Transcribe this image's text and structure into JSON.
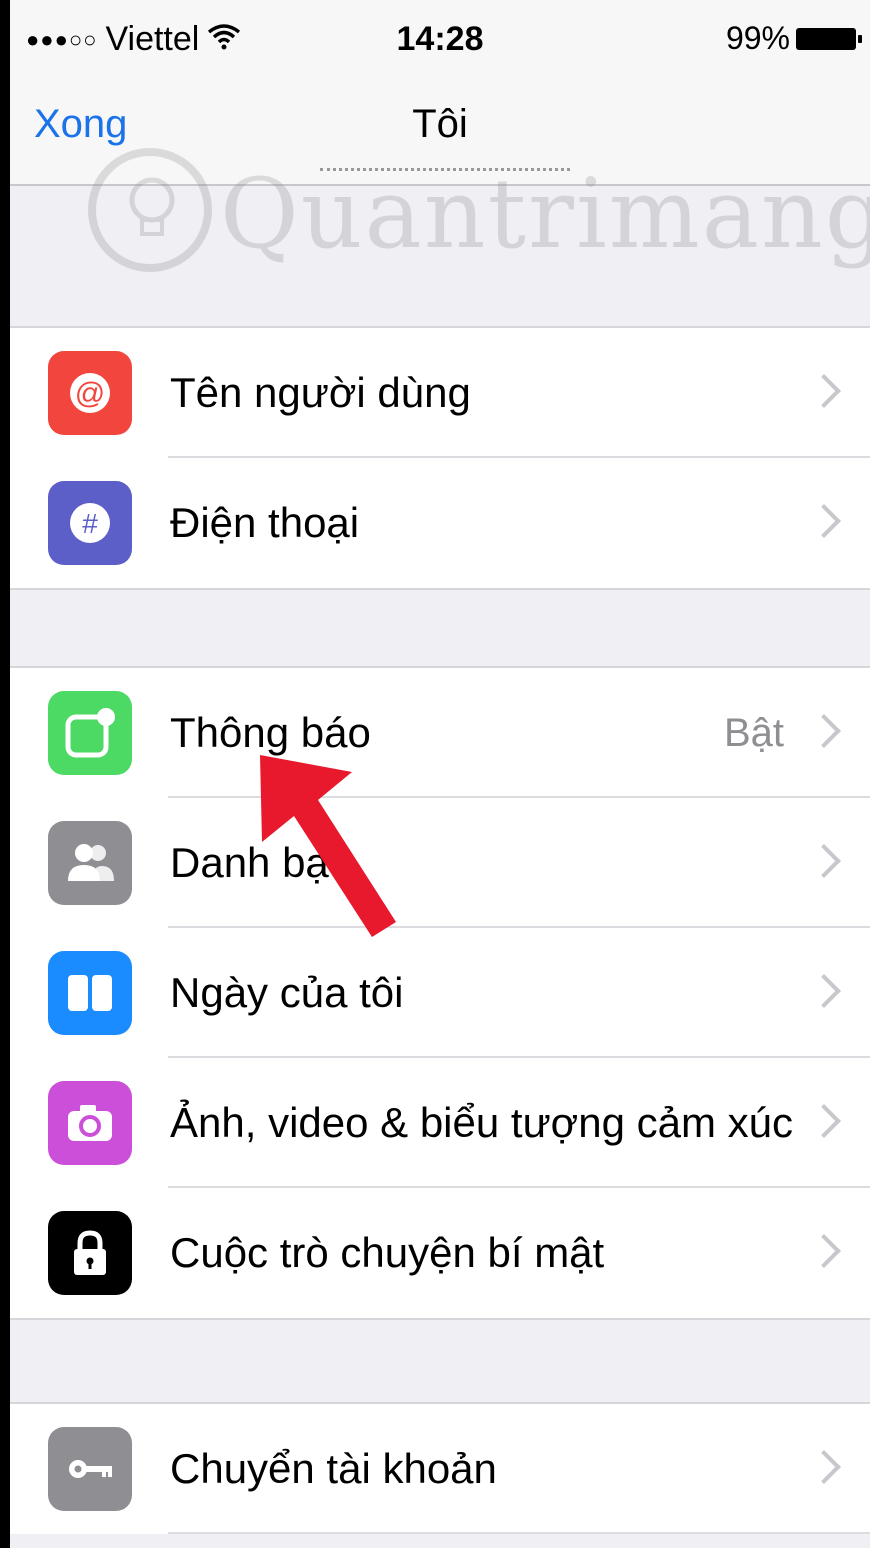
{
  "status_bar": {
    "signal": "●●●○○",
    "carrier": "Viettel",
    "time": "14:28",
    "battery": "99%"
  },
  "nav": {
    "left_button": "Xong",
    "title": "Tôi"
  },
  "watermark": {
    "text": "Quantrimang"
  },
  "group1": [
    {
      "label": "Tên người dùng",
      "icon": "at-icon",
      "color": "#f2453d"
    },
    {
      "label": "Điện thoại",
      "icon": "hash-icon",
      "color": "#5b5fc7"
    }
  ],
  "group2": [
    {
      "label": "Thông báo",
      "value": "Bật",
      "icon": "notification-icon",
      "color": "#4cd964"
    },
    {
      "label": "Danh bạ",
      "icon": "contacts-icon",
      "color": "#8e8e93"
    },
    {
      "label": "Ngày của tôi",
      "icon": "my-day-icon",
      "color": "#1a8cff"
    },
    {
      "label": "Ảnh, video & biểu tượng cảm xúc",
      "icon": "camera-icon",
      "color": "#cc4fd9"
    },
    {
      "label": "Cuộc trò chuyện bí mật",
      "icon": "lock-icon",
      "color": "#000000"
    }
  ],
  "group3": [
    {
      "label": "Chuyển tài khoản",
      "icon": "key-icon",
      "color": "#8e8e93"
    }
  ],
  "colors": {
    "accent": "#1a73e8",
    "annotation_arrow": "#e8192c"
  }
}
